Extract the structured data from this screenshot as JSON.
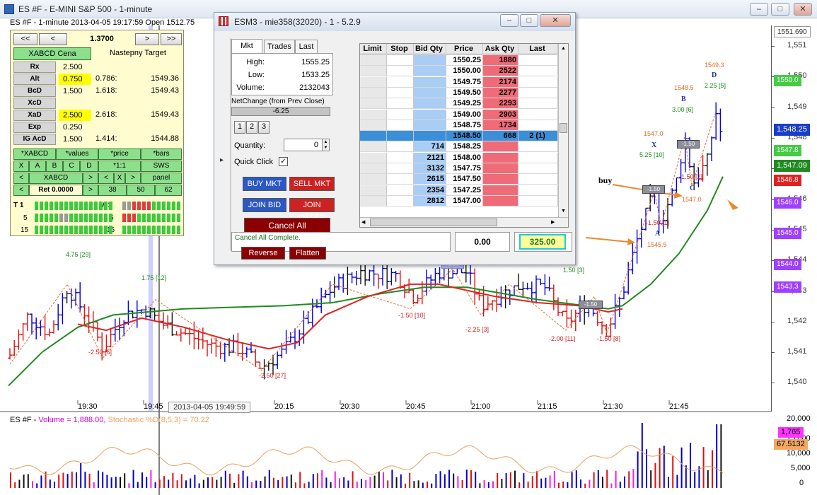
{
  "window": {
    "title": "ES #F - E-MINI S&P 500 - 1-minute",
    "chart_header": "ES #F - 1-minute 2013-04-05 19:17:59 Open 1512.75"
  },
  "price_scale": {
    "ticks": [
      "1,551",
      "1,550",
      "1,549",
      "1,548",
      "1,547",
      "1,546",
      "1,545",
      "1,544",
      "1,543",
      "1,542",
      "1,541",
      "1,540"
    ],
    "boxes": [
      {
        "label": "1551.690",
        "bg": "#ffffff",
        "fg": "#333333"
      },
      {
        "label": "1550.0",
        "bg": "#44cc44",
        "fg": "#ffffff"
      },
      {
        "label": "1,548.25",
        "bg": "#1a3dc9",
        "fg": "#ffffff"
      },
      {
        "label": "1547.8",
        "bg": "#44cc44",
        "fg": "#ffffff"
      },
      {
        "label": "1,547.09",
        "bg": "#1e8b1e",
        "fg": "#ffffff"
      },
      {
        "label": "1546.8",
        "bg": "#dd2222",
        "fg": "#ffffff"
      },
      {
        "label": "1546.0",
        "bg": "#a040ff",
        "fg": "#ffffff"
      },
      {
        "label": "1545.0",
        "bg": "#a040ff",
        "fg": "#ffffff"
      },
      {
        "label": "1544.0",
        "bg": "#a040ff",
        "fg": "#ffffff"
      },
      {
        "label": "1543.3",
        "bg": "#a040ff",
        "fg": "#ffffff"
      }
    ]
  },
  "time_axis": [
    "19:30",
    "19:45",
    "20:15",
    "20:30",
    "20:45",
    "21:00",
    "21:15",
    "21:30",
    "21:45"
  ],
  "cursor_time": "2013-04-05 19:49:59",
  "annotations": {
    "buy": "buy",
    "swings": [
      "4.75 [29]",
      "1.75 [12]",
      "-2.50 [5]",
      "-2.50 [27]",
      "-1.50 [10]",
      "-2.25 [3]",
      "-2.00 [11]",
      "-1.50 [8]",
      "1.50 [3]",
      "-1.50 [1]",
      "5.25 [10]",
      "1547.0",
      "-1.50 [2]",
      "1547.0",
      "3.00 [6]",
      "1548.5",
      "2.25 [5]",
      "1549.3",
      "1545.5"
    ],
    "points": [
      "X",
      "A",
      "B",
      "C",
      "D"
    ],
    "chips": [
      "-1.50",
      "-1.50",
      "-1.50",
      "-1.50"
    ]
  },
  "volume_panel": {
    "header_symbol": "ES #F - ",
    "header_volume": "Volume = 1,888.00,",
    "header_stoch": " Stochastic %D(8,5,3) = 70.22",
    "ticks": [
      "20,000",
      "15,000",
      "10,000",
      "5,000",
      "0"
    ],
    "box_vol": "1,765",
    "box_stoch": "67.5132"
  },
  "abcd_panel": {
    "nav": [
      "<<",
      "<",
      "1.3700",
      ">",
      ">>"
    ],
    "header_left": "XABCD Cena",
    "header_right": "Nastepny Target",
    "rows": [
      {
        "label": "Rx",
        "v1": "2.500",
        "v2": "",
        "v3": "",
        "hl": false
      },
      {
        "label": "Alt",
        "v1": "0.750",
        "v2": "0.786:",
        "v3": "1549.36",
        "hl": true
      },
      {
        "label": "BcD",
        "v1": "1.500",
        "v2": "1.618:",
        "v3": "1549.43",
        "hl": false
      },
      {
        "label": "XcD",
        "v1": "",
        "v2": "",
        "v3": "",
        "hl": false
      },
      {
        "label": "XaD",
        "v1": "2.500",
        "v2": "2.618:",
        "v3": "1549.43",
        "hl": true
      },
      {
        "label": "Exp",
        "v1": "0.250",
        "v2": "",
        "v3": "",
        "hl": false
      },
      {
        "label": "IG AcD",
        "v1": "1.500",
        "v2": "1.414:",
        "v3": "1544.88",
        "hl": false
      }
    ],
    "grid_row1": [
      "*XABCD",
      "*values",
      "*price",
      "*bars"
    ],
    "grid_row2": [
      "X",
      "A",
      "B",
      "C",
      "D",
      "*1:1",
      "SWS"
    ],
    "grid_row3": [
      "<",
      "XABCD",
      ">",
      "<",
      "X",
      ">",
      "panel"
    ],
    "grid_row4": [
      "<",
      "Ret 0.0000",
      ">",
      "38",
      "50",
      "62"
    ],
    "bars": [
      {
        "left": "T 1",
        "right": "M 1"
      },
      {
        "left": "5",
        "right": "5"
      },
      {
        "left": "15",
        "right": "15"
      }
    ]
  },
  "order_dialog": {
    "title": "ESM3 - mie358(32020) - 1 - 5.2.9",
    "tabs": [
      "Mkt",
      "Trades",
      "Last"
    ],
    "stats": [
      {
        "label": "High:",
        "value": "1555.25"
      },
      {
        "label": "Low:",
        "value": "1533.25"
      },
      {
        "label": "Volume:",
        "value": "2132043"
      }
    ],
    "netchange_label": "NetChange (from Prev Close)",
    "netchange_value": "-6.25",
    "size_buttons": [
      "1",
      "2",
      "3"
    ],
    "quantity_label": "Quantity:",
    "quantity_value": "0",
    "quick_click_label": "Quick Click",
    "quick_click_mark": "✓",
    "buttons": {
      "buy_mkt": "BUY MKT",
      "sell_mkt": "SELL MKT",
      "join_bid": "JOIN BID",
      "join_offer": "JOIN OFFER",
      "cancel_all": "Cancel All",
      "reverse": "Reverse",
      "flatten": "Flatten"
    },
    "status": "Cancel All Complete.",
    "pnl": "0.00",
    "pnl2": "325.00",
    "ladder_headers": [
      "Limit",
      "Stop",
      "Bid Qty",
      "Price",
      "Ask Qty",
      "Last"
    ],
    "ladder_rows": [
      {
        "bid": "",
        "price": "1550.25",
        "ask": "1880",
        "last": ""
      },
      {
        "bid": "",
        "price": "1550.00",
        "ask": "2522",
        "last": ""
      },
      {
        "bid": "",
        "price": "1549.75",
        "ask": "2174",
        "last": ""
      },
      {
        "bid": "",
        "price": "1549.50",
        "ask": "2277",
        "last": ""
      },
      {
        "bid": "",
        "price": "1549.25",
        "ask": "2293",
        "last": ""
      },
      {
        "bid": "",
        "price": "1549.00",
        "ask": "2903",
        "last": ""
      },
      {
        "bid": "",
        "price": "1548.75",
        "ask": "1734",
        "last": ""
      },
      {
        "bid": "",
        "price": "1548.50",
        "ask": "668",
        "last": "2 (1)"
      },
      {
        "bid": "714",
        "price": "1548.25",
        "ask": "",
        "last": ""
      },
      {
        "bid": "2121",
        "price": "1548.00",
        "ask": "",
        "last": ""
      },
      {
        "bid": "3132",
        "price": "1547.75",
        "ask": "",
        "last": ""
      },
      {
        "bid": "2615",
        "price": "1547.50",
        "ask": "",
        "last": ""
      },
      {
        "bid": "2354",
        "price": "1547.25",
        "ask": "",
        "last": ""
      },
      {
        "bid": "2812",
        "price": "1547.00",
        "ask": "",
        "last": ""
      }
    ]
  }
}
